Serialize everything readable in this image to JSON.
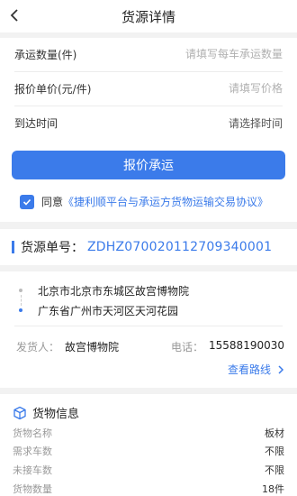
{
  "header": {
    "title": "货源详情"
  },
  "form": {
    "quantity": {
      "label": "承运数量(件)",
      "placeholder": "请填写每车承运数量"
    },
    "price": {
      "label": "报价单价(元/件)",
      "placeholder": "请填写价格"
    },
    "arrival": {
      "label": "到达时间",
      "value": "请选择时间"
    },
    "submit_label": "报价承运",
    "agree_text": "同意",
    "agree_link": "《捷利顺平台与承运方货物运输交易协议》"
  },
  "order": {
    "label": "货源单号：",
    "number": "ZDHZ070020112709340001"
  },
  "route": {
    "from": "北京市北京市东城区故宫博物院",
    "to": "广东省广州市天河区天河花园",
    "shipper_label": "发货人：",
    "shipper_name": "故宫博物院",
    "phone_label": "电话：",
    "phone": "15588190030",
    "view_route": "查看路线"
  },
  "cargo": {
    "title": "货物信息",
    "rows": [
      {
        "k": "货物名称",
        "v": "板材"
      },
      {
        "k": "需求车数",
        "v": "不限"
      },
      {
        "k": "未接车数",
        "v": "不限"
      },
      {
        "k": "货物数量",
        "v": "18件"
      }
    ]
  },
  "colors": {
    "accent": "#3b7bea",
    "background": "#f2f2f2"
  },
  "icons": {
    "back": "chevron-left-icon",
    "check": "checkmark-icon",
    "cargo": "box-icon",
    "arrow": "chevron-right-icon"
  }
}
